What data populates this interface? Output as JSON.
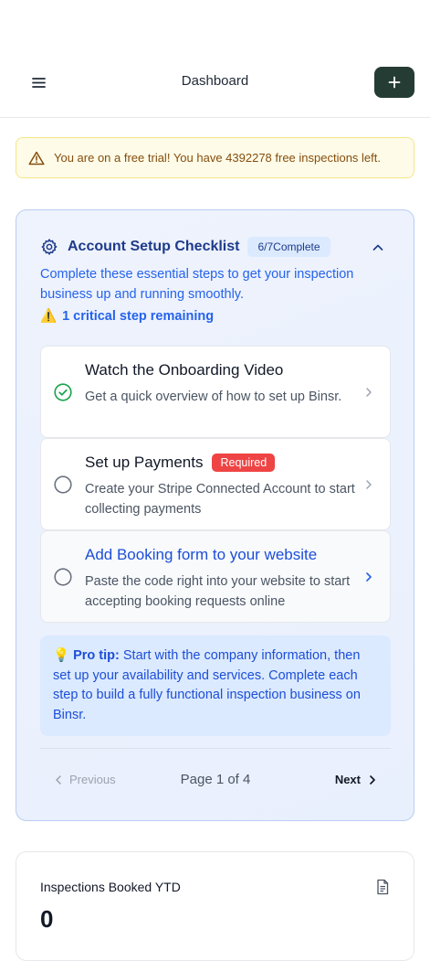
{
  "header": {
    "title": "Dashboard",
    "menu_icon": "hamburger-menu-icon",
    "add_icon": "plus-icon",
    "add_button_color": "#253c34"
  },
  "trial_banner": {
    "icon": "warning-triangle-icon",
    "text": "You are on a free trial! You have 4392278 free inspections left."
  },
  "checklist": {
    "icon": "gear-icon",
    "title": "Account Setup Checklist",
    "badge": "6/7Complete",
    "collapse_icon": "chevron-up-icon",
    "description": "Complete these essential steps to get your inspection business up and running smoothly.",
    "critical_icon": "⚠️",
    "critical_text": "1 critical step remaining",
    "steps": [
      {
        "title": "Watch the Onboarding Video",
        "description": "Get a quick overview of how to set up Binsr.",
        "status": "complete",
        "badge": ""
      },
      {
        "title": "Set up Payments",
        "description": "Create your Stripe Connected Account to start collecting payments",
        "status": "incomplete",
        "badge": "Required"
      },
      {
        "title": "Add Booking form to your website",
        "description": "Paste the code right into your website to start accepting booking requests online",
        "status": "incomplete",
        "badge": ""
      }
    ],
    "protip": {
      "icon": "💡",
      "label": "Pro tip:",
      "text": " Start with the company information, then set up your availability and services. Complete each step to build a fully functional inspection business on Binsr."
    },
    "pagination": {
      "previous": "Previous",
      "page_indicator": "Page 1 of 4",
      "next": "Next"
    }
  },
  "stats": {
    "label": "Inspections Booked YTD",
    "value": "0",
    "icon": "document-icon"
  },
  "colors": {
    "accent_blue": "#2563eb",
    "success_green": "#16a34a",
    "required_red": "#ef4444"
  }
}
